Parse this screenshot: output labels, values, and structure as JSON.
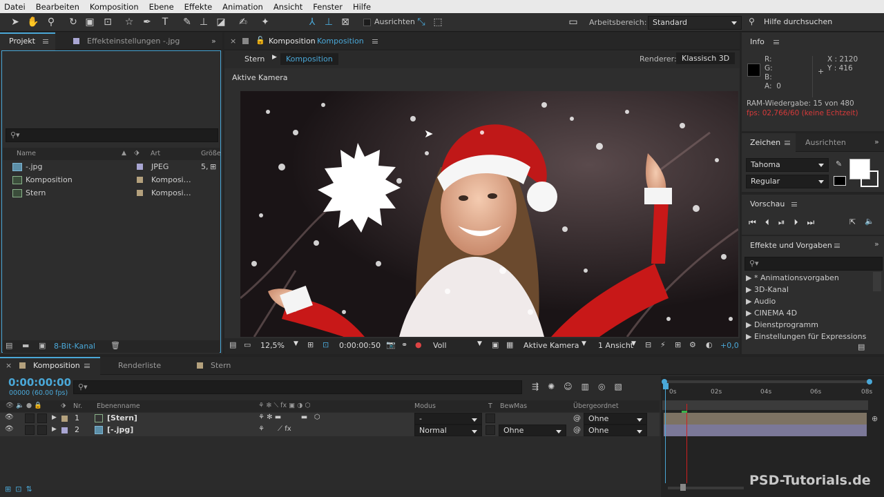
{
  "menu": [
    "Datei",
    "Bearbeiten",
    "Komposition",
    "Ebene",
    "Effekte",
    "Animation",
    "Ansicht",
    "Fenster",
    "Hilfe"
  ],
  "toolbar": {
    "snap_label": "Ausrichten",
    "workspace_label": "Arbeitsbereich:",
    "workspace_value": "Standard",
    "help_placeholder": "Hilfe durchsuchen"
  },
  "project": {
    "tab_project": "Projekt",
    "tab_effects": "Effekteinstellungen -.jpg",
    "col_name": "Name",
    "col_type": "Art",
    "col_size": "Größe",
    "items": [
      {
        "name": "-.jpg",
        "type": "JPEG",
        "size": "5,"
      },
      {
        "name": "Komposition",
        "type": "Komposi…",
        "size": ""
      },
      {
        "name": "Stern",
        "type": "Komposi…",
        "size": ""
      }
    ],
    "bit_depth": "8-Bit-Kanal"
  },
  "comp": {
    "tab_label": "Komposition",
    "tab_name": "Komposition",
    "breadcrumb": [
      "Stern",
      "Komposition"
    ],
    "renderer_label": "Renderer:",
    "renderer_value": "Klassisch 3D",
    "camera_label": "Aktive Kamera",
    "zoom": "12,5%",
    "timecode": "0:00:00:50",
    "resolution": "Voll",
    "camera_dd": "Aktive Kamera",
    "views": "1 Ansicht",
    "exposure": "+0,0"
  },
  "info": {
    "title": "Info",
    "r": "R:",
    "g": "G:",
    "b": "B:",
    "a": "A:",
    "a_val": "0",
    "x": "X : 2120",
    "y": "Y : 416",
    "ram": "RAM-Wiedergabe: 15 von 480",
    "fps": "fps: 02,766/60 (keine Echtzeit)"
  },
  "char": {
    "tab_zeichen": "Zeichen",
    "tab_ausrichten": "Ausrichten",
    "font": "Tahoma",
    "style": "Regular"
  },
  "preview": {
    "title": "Vorschau"
  },
  "effects": {
    "title": "Effekte und Vorgaben",
    "items": [
      "* Animationsvorgaben",
      "3D-Kanal",
      "Audio",
      "CINEMA 4D",
      "Dienstprogramm",
      "Einstellungen für Expressions"
    ]
  },
  "timeline": {
    "tab_comp": "Komposition",
    "tab_render": "Renderliste",
    "tab_stern": "Stern",
    "timecode": "0:00:00:00",
    "frames": "00000 (60.00 fps)",
    "col_nr": "Nr.",
    "col_name": "Ebenenname",
    "col_mode": "Modus",
    "col_t": "T",
    "col_track": "BewMas",
    "col_parent": "Übergeordnet",
    "ticks": [
      "0s",
      "02s",
      "04s",
      "06s",
      "08s"
    ],
    "layers": [
      {
        "nr": "1",
        "name": "[Stern]",
        "mode": "-",
        "track": "",
        "parent": "Ohne",
        "color": "#b4a17d"
      },
      {
        "nr": "2",
        "name": "[-.jpg]",
        "mode": "Normal",
        "track": "Ohne",
        "parent": "Ohne",
        "color": "#a9a6d3"
      }
    ]
  },
  "watermark": "PSD-Tutorials.de",
  "colors": {
    "accent": "#4aa8d8",
    "fps_red": "#d63a3a",
    "playhead": "#d02020"
  }
}
